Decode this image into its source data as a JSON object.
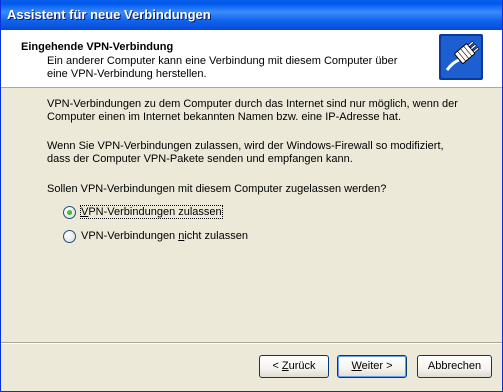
{
  "window": {
    "title": "Assistent für neue Verbindungen"
  },
  "header": {
    "title": "Eingehende VPN-Verbindung",
    "description": "Ein anderer Computer kann eine Verbindung mit diesem Computer über eine VPN-Verbindung herstellen.",
    "icon": "vpn-cable-plug-icon"
  },
  "body": {
    "paragraph1": "VPN-Verbindungen zu dem Computer durch das Internet sind nur möglich, wenn der Computer einen im Internet bekannten Namen bzw. eine IP-Adresse hat.",
    "paragraph2": "Wenn Sie VPN-Verbindungen zulassen, wird der Windows-Firewall so modifiziert, dass der Computer VPN-Pakete senden und empfangen kann.",
    "question": "Sollen VPN-Verbindungen mit diesem Computer zugelassen werden?"
  },
  "options": [
    {
      "label_pre": "",
      "label_accel": "V",
      "label_post": "PN-Verbindungen zulassen",
      "selected": true
    },
    {
      "label_pre": "VPN-Verbindungen ",
      "label_accel": "n",
      "label_post": "icht zulassen",
      "selected": false
    }
  ],
  "buttons": {
    "back": {
      "pre": "< ",
      "accel": "Z",
      "post": "urück"
    },
    "next": {
      "pre": "",
      "accel": "W",
      "post": "eiter >"
    },
    "cancel": "Abbrechen"
  },
  "colors": {
    "titlebar": "#0058ee",
    "dialog_bg": "#ece9d8",
    "radio_selected": "#21a121"
  }
}
